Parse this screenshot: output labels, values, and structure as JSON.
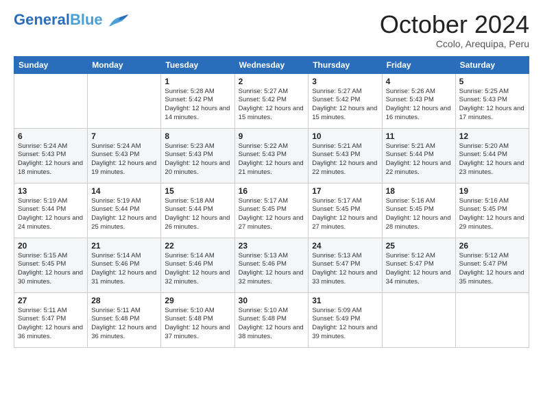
{
  "header": {
    "logo_general": "General",
    "logo_blue": "Blue",
    "title": "October 2024",
    "subtitle": "Ccolo, Arequipa, Peru"
  },
  "calendar": {
    "days_of_week": [
      "Sunday",
      "Monday",
      "Tuesday",
      "Wednesday",
      "Thursday",
      "Friday",
      "Saturday"
    ],
    "weeks": [
      [
        {
          "day": "",
          "sunrise": "",
          "sunset": "",
          "daylight": ""
        },
        {
          "day": "",
          "sunrise": "",
          "sunset": "",
          "daylight": ""
        },
        {
          "day": "1",
          "sunrise": "Sunrise: 5:28 AM",
          "sunset": "Sunset: 5:42 PM",
          "daylight": "Daylight: 12 hours and 14 minutes."
        },
        {
          "day": "2",
          "sunrise": "Sunrise: 5:27 AM",
          "sunset": "Sunset: 5:42 PM",
          "daylight": "Daylight: 12 hours and 15 minutes."
        },
        {
          "day": "3",
          "sunrise": "Sunrise: 5:27 AM",
          "sunset": "Sunset: 5:42 PM",
          "daylight": "Daylight: 12 hours and 15 minutes."
        },
        {
          "day": "4",
          "sunrise": "Sunrise: 5:26 AM",
          "sunset": "Sunset: 5:43 PM",
          "daylight": "Daylight: 12 hours and 16 minutes."
        },
        {
          "day": "5",
          "sunrise": "Sunrise: 5:25 AM",
          "sunset": "Sunset: 5:43 PM",
          "daylight": "Daylight: 12 hours and 17 minutes."
        }
      ],
      [
        {
          "day": "6",
          "sunrise": "Sunrise: 5:24 AM",
          "sunset": "Sunset: 5:43 PM",
          "daylight": "Daylight: 12 hours and 18 minutes."
        },
        {
          "day": "7",
          "sunrise": "Sunrise: 5:24 AM",
          "sunset": "Sunset: 5:43 PM",
          "daylight": "Daylight: 12 hours and 19 minutes."
        },
        {
          "day": "8",
          "sunrise": "Sunrise: 5:23 AM",
          "sunset": "Sunset: 5:43 PM",
          "daylight": "Daylight: 12 hours and 20 minutes."
        },
        {
          "day": "9",
          "sunrise": "Sunrise: 5:22 AM",
          "sunset": "Sunset: 5:43 PM",
          "daylight": "Daylight: 12 hours and 21 minutes."
        },
        {
          "day": "10",
          "sunrise": "Sunrise: 5:21 AM",
          "sunset": "Sunset: 5:43 PM",
          "daylight": "Daylight: 12 hours and 22 minutes."
        },
        {
          "day": "11",
          "sunrise": "Sunrise: 5:21 AM",
          "sunset": "Sunset: 5:44 PM",
          "daylight": "Daylight: 12 hours and 22 minutes."
        },
        {
          "day": "12",
          "sunrise": "Sunrise: 5:20 AM",
          "sunset": "Sunset: 5:44 PM",
          "daylight": "Daylight: 12 hours and 23 minutes."
        }
      ],
      [
        {
          "day": "13",
          "sunrise": "Sunrise: 5:19 AM",
          "sunset": "Sunset: 5:44 PM",
          "daylight": "Daylight: 12 hours and 24 minutes."
        },
        {
          "day": "14",
          "sunrise": "Sunrise: 5:19 AM",
          "sunset": "Sunset: 5:44 PM",
          "daylight": "Daylight: 12 hours and 25 minutes."
        },
        {
          "day": "15",
          "sunrise": "Sunrise: 5:18 AM",
          "sunset": "Sunset: 5:44 PM",
          "daylight": "Daylight: 12 hours and 26 minutes."
        },
        {
          "day": "16",
          "sunrise": "Sunrise: 5:17 AM",
          "sunset": "Sunset: 5:45 PM",
          "daylight": "Daylight: 12 hours and 27 minutes."
        },
        {
          "day": "17",
          "sunrise": "Sunrise: 5:17 AM",
          "sunset": "Sunset: 5:45 PM",
          "daylight": "Daylight: 12 hours and 27 minutes."
        },
        {
          "day": "18",
          "sunrise": "Sunrise: 5:16 AM",
          "sunset": "Sunset: 5:45 PM",
          "daylight": "Daylight: 12 hours and 28 minutes."
        },
        {
          "day": "19",
          "sunrise": "Sunrise: 5:16 AM",
          "sunset": "Sunset: 5:45 PM",
          "daylight": "Daylight: 12 hours and 29 minutes."
        }
      ],
      [
        {
          "day": "20",
          "sunrise": "Sunrise: 5:15 AM",
          "sunset": "Sunset: 5:45 PM",
          "daylight": "Daylight: 12 hours and 30 minutes."
        },
        {
          "day": "21",
          "sunrise": "Sunrise: 5:14 AM",
          "sunset": "Sunset: 5:46 PM",
          "daylight": "Daylight: 12 hours and 31 minutes."
        },
        {
          "day": "22",
          "sunrise": "Sunrise: 5:14 AM",
          "sunset": "Sunset: 5:46 PM",
          "daylight": "Daylight: 12 hours and 32 minutes."
        },
        {
          "day": "23",
          "sunrise": "Sunrise: 5:13 AM",
          "sunset": "Sunset: 5:46 PM",
          "daylight": "Daylight: 12 hours and 32 minutes."
        },
        {
          "day": "24",
          "sunrise": "Sunrise: 5:13 AM",
          "sunset": "Sunset: 5:47 PM",
          "daylight": "Daylight: 12 hours and 33 minutes."
        },
        {
          "day": "25",
          "sunrise": "Sunrise: 5:12 AM",
          "sunset": "Sunset: 5:47 PM",
          "daylight": "Daylight: 12 hours and 34 minutes."
        },
        {
          "day": "26",
          "sunrise": "Sunrise: 5:12 AM",
          "sunset": "Sunset: 5:47 PM",
          "daylight": "Daylight: 12 hours and 35 minutes."
        }
      ],
      [
        {
          "day": "27",
          "sunrise": "Sunrise: 5:11 AM",
          "sunset": "Sunset: 5:47 PM",
          "daylight": "Daylight: 12 hours and 36 minutes."
        },
        {
          "day": "28",
          "sunrise": "Sunrise: 5:11 AM",
          "sunset": "Sunset: 5:48 PM",
          "daylight": "Daylight: 12 hours and 36 minutes."
        },
        {
          "day": "29",
          "sunrise": "Sunrise: 5:10 AM",
          "sunset": "Sunset: 5:48 PM",
          "daylight": "Daylight: 12 hours and 37 minutes."
        },
        {
          "day": "30",
          "sunrise": "Sunrise: 5:10 AM",
          "sunset": "Sunset: 5:48 PM",
          "daylight": "Daylight: 12 hours and 38 minutes."
        },
        {
          "day": "31",
          "sunrise": "Sunrise: 5:09 AM",
          "sunset": "Sunset: 5:49 PM",
          "daylight": "Daylight: 12 hours and 39 minutes."
        },
        {
          "day": "",
          "sunrise": "",
          "sunset": "",
          "daylight": ""
        },
        {
          "day": "",
          "sunrise": "",
          "sunset": "",
          "daylight": ""
        }
      ]
    ]
  }
}
